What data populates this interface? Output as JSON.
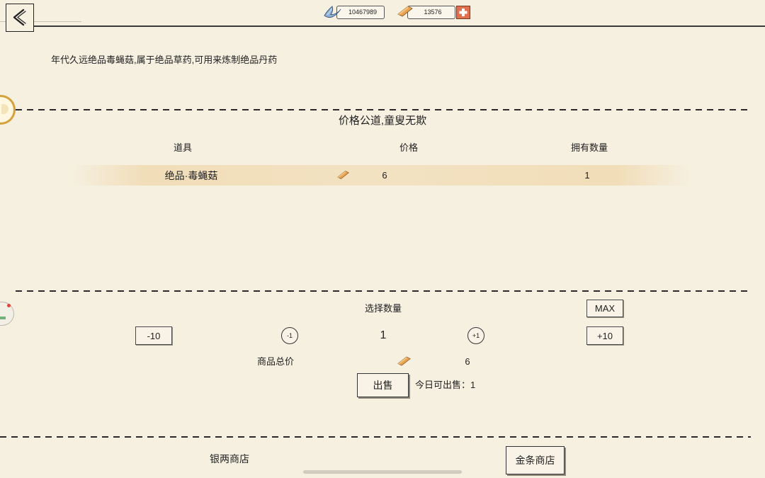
{
  "header": {
    "back_icon": "back-chevron-icon",
    "silver": {
      "icon": "silver-ingot-icon",
      "amount": "10467989"
    },
    "gold": {
      "icon": "gold-bar-icon",
      "amount": "13576",
      "add_icon": "plus-icon"
    }
  },
  "description": "年代久远绝品毒蝇菇,属于绝品草药,可用来炼制绝品丹药",
  "shop": {
    "slogan": "价格公道,童叟无欺",
    "columns": [
      "道具",
      "价格",
      "拥有数量"
    ],
    "items": [
      {
        "name": "绝品·毒蝇菇",
        "price_icon": "gold-bar-icon",
        "price": "6",
        "owned": "1"
      }
    ]
  },
  "quantity": {
    "label": "选择数量",
    "max": "MAX",
    "minus10": "-10",
    "minus1": "-1",
    "value": "1",
    "plus1": "+1",
    "plus10": "+10"
  },
  "total": {
    "label": "商品总价",
    "icon": "gold-bar-icon",
    "value": "6"
  },
  "sell": {
    "button": "出售",
    "daily_limit": "今日可出售：1"
  },
  "tabs": [
    {
      "label": "银两商店",
      "selected": false
    },
    {
      "label": "金条商店",
      "selected": true
    }
  ],
  "side_icons": [
    "avatar-icon",
    "task-icon"
  ],
  "colors": {
    "background": "#f6f0e1",
    "highlight": "#f1ddb8",
    "gold": "#e9a24f",
    "add_button": "#e0704e",
    "text": "#222222"
  }
}
